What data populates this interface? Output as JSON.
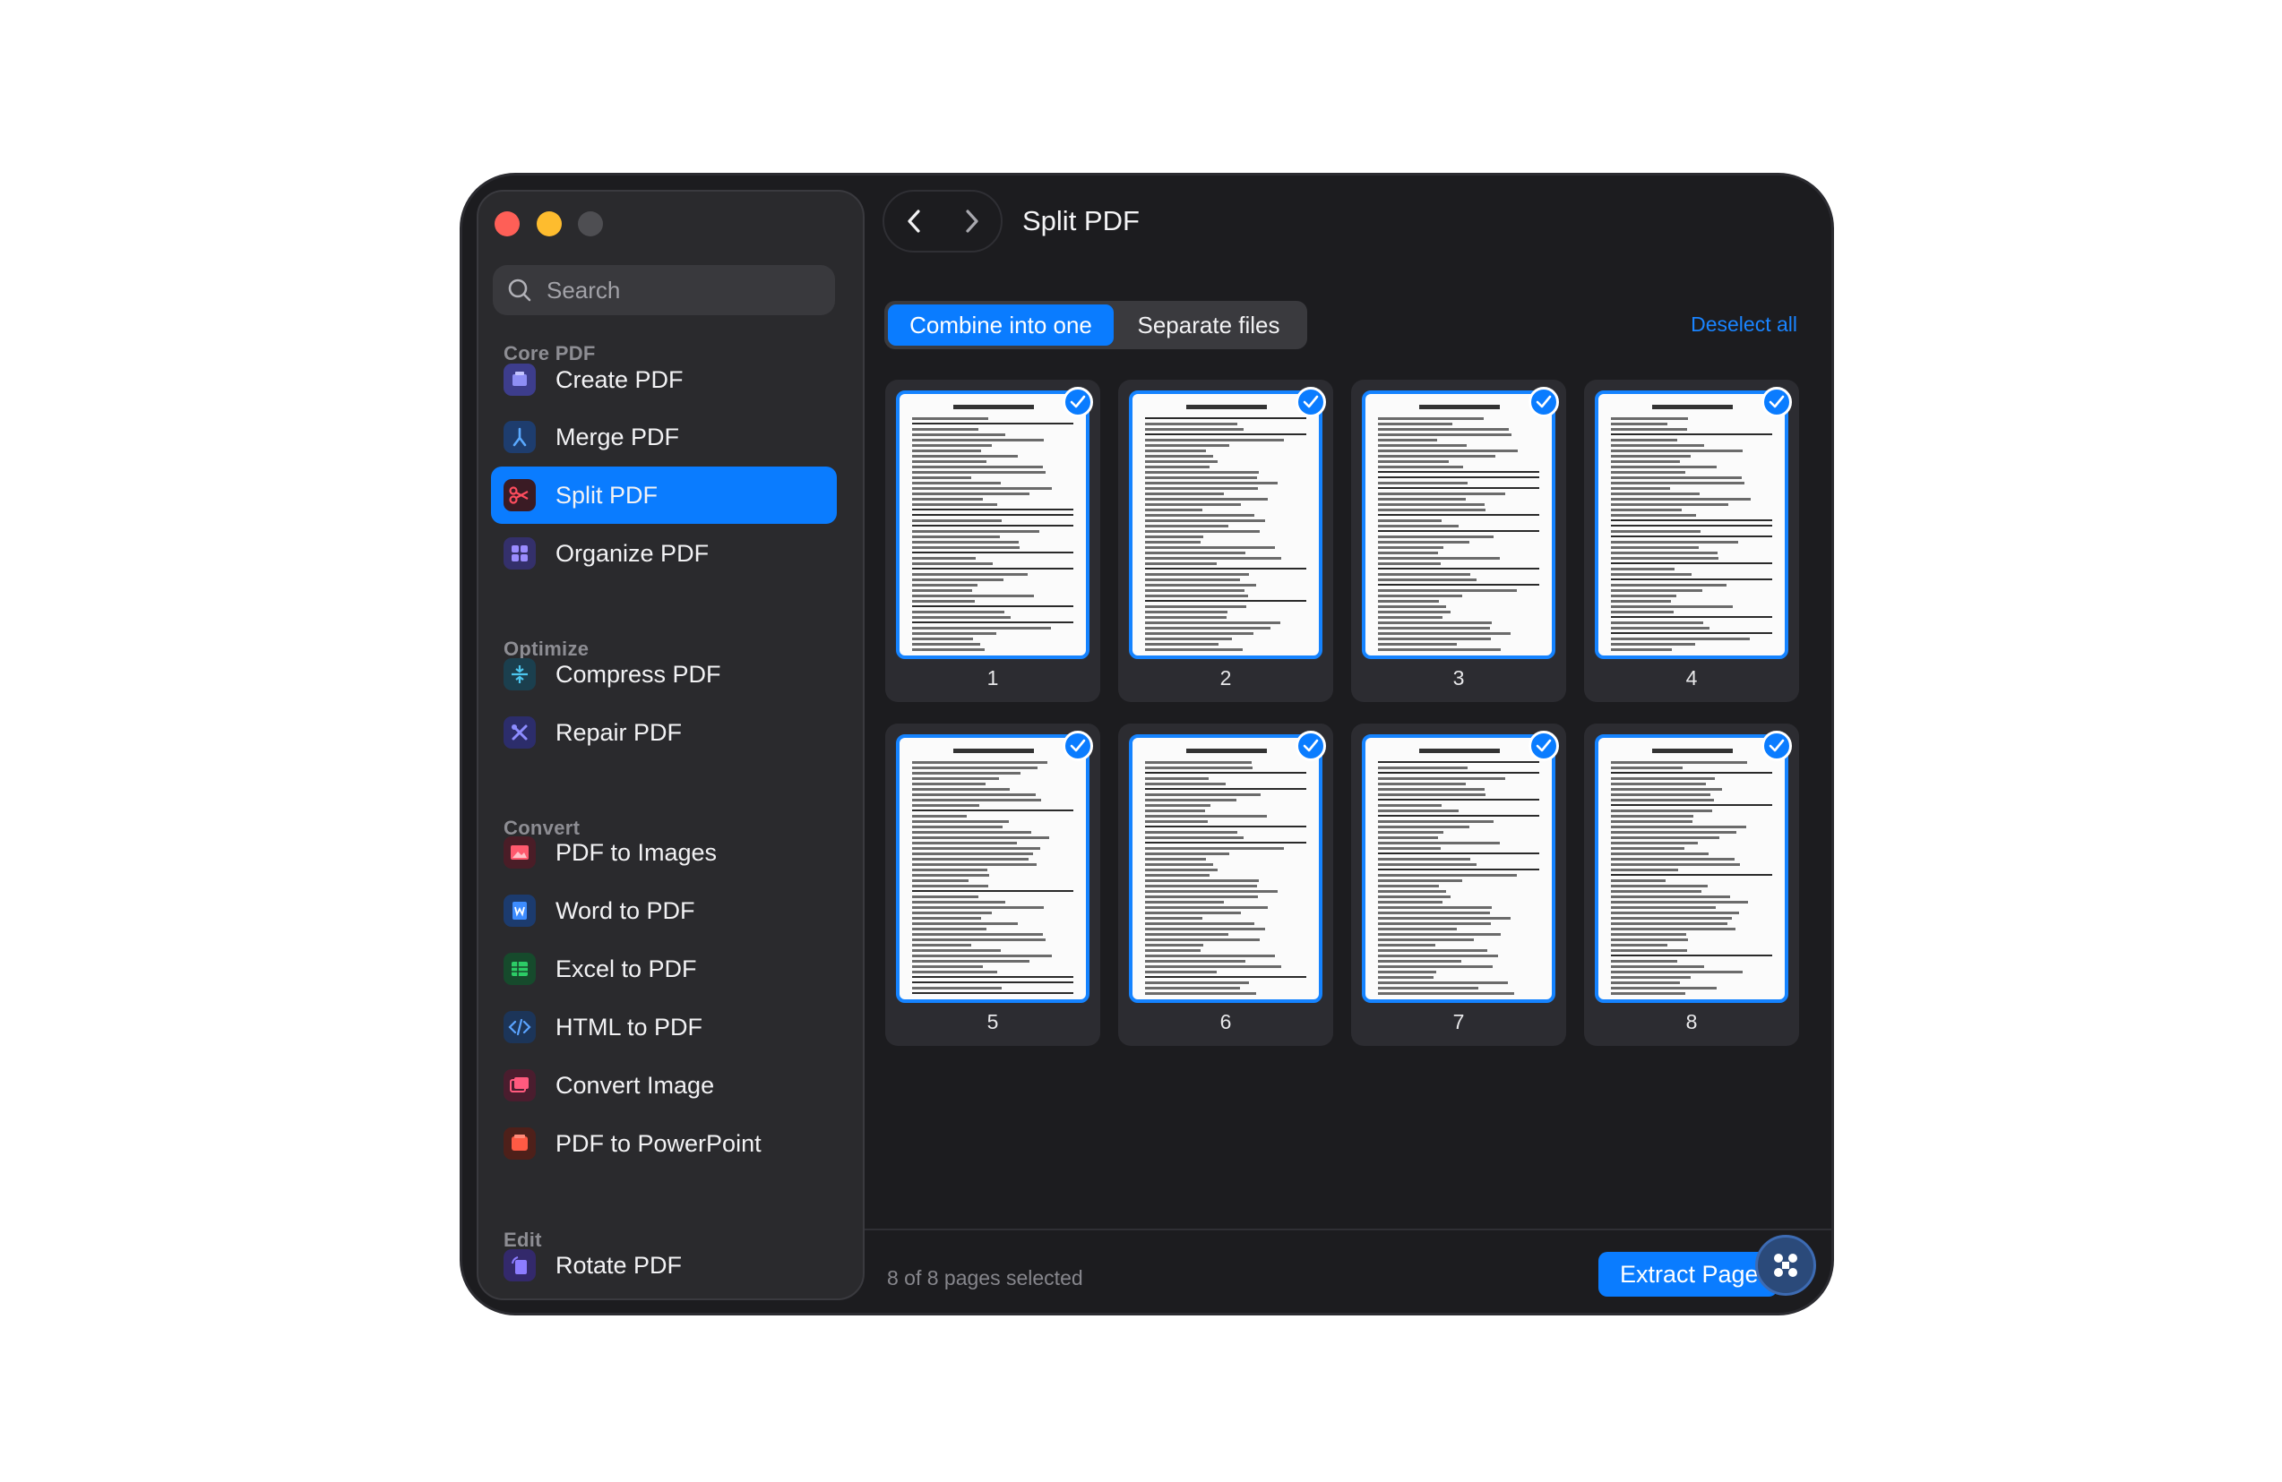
{
  "window": {
    "title": "Split PDF"
  },
  "sidebar": {
    "search_placeholder": "Search",
    "sections": [
      {
        "label": "Core PDF",
        "items": [
          {
            "label": "Create PDF",
            "icon": "create-pdf-icon",
            "color": "#5b5bd6"
          },
          {
            "label": "Merge PDF",
            "icon": "merge-icon",
            "color": "#2a7be8"
          },
          {
            "label": "Split PDF",
            "icon": "scissors-icon",
            "color": "#e8384a",
            "active": true
          },
          {
            "label": "Organize PDF",
            "icon": "grid-icon",
            "color": "#7061e8"
          }
        ]
      },
      {
        "label": "Optimize",
        "items": [
          {
            "label": "Compress PDF",
            "icon": "compress-icon",
            "color": "#2fa9d6"
          },
          {
            "label": "Repair PDF",
            "icon": "tools-icon",
            "color": "#6a6ae8"
          }
        ]
      },
      {
        "label": "Convert",
        "items": [
          {
            "label": "PDF to Images",
            "icon": "image-icon",
            "color": "#e8465a"
          },
          {
            "label": "Word to PDF",
            "icon": "word-icon",
            "color": "#2d7de8"
          },
          {
            "label": "Excel to PDF",
            "icon": "excel-icon",
            "color": "#22b35a"
          },
          {
            "label": "HTML to PDF",
            "icon": "code-icon",
            "color": "#3a7bd5"
          },
          {
            "label": "Convert Image",
            "icon": "convert-image-icon",
            "color": "#e84a6e"
          },
          {
            "label": "PDF to PowerPoint",
            "icon": "powerpoint-icon",
            "color": "#ee5340"
          }
        ]
      },
      {
        "label": "Edit",
        "items": [
          {
            "label": "Rotate PDF",
            "icon": "rotate-icon",
            "color": "#6a5be8"
          }
        ]
      }
    ]
  },
  "toolbar": {
    "mode_combine": "Combine into one",
    "mode_separate": "Separate files",
    "deselect_all": "Deselect all"
  },
  "pages": [
    {
      "number": "1",
      "selected": true
    },
    {
      "number": "2",
      "selected": true
    },
    {
      "number": "3",
      "selected": true
    },
    {
      "number": "4",
      "selected": true
    },
    {
      "number": "5",
      "selected": true
    },
    {
      "number": "6",
      "selected": true
    },
    {
      "number": "7",
      "selected": true
    },
    {
      "number": "8",
      "selected": true
    }
  ],
  "footer": {
    "selection_status": "8 of 8 pages selected",
    "extract_label": "Extract Pages"
  }
}
